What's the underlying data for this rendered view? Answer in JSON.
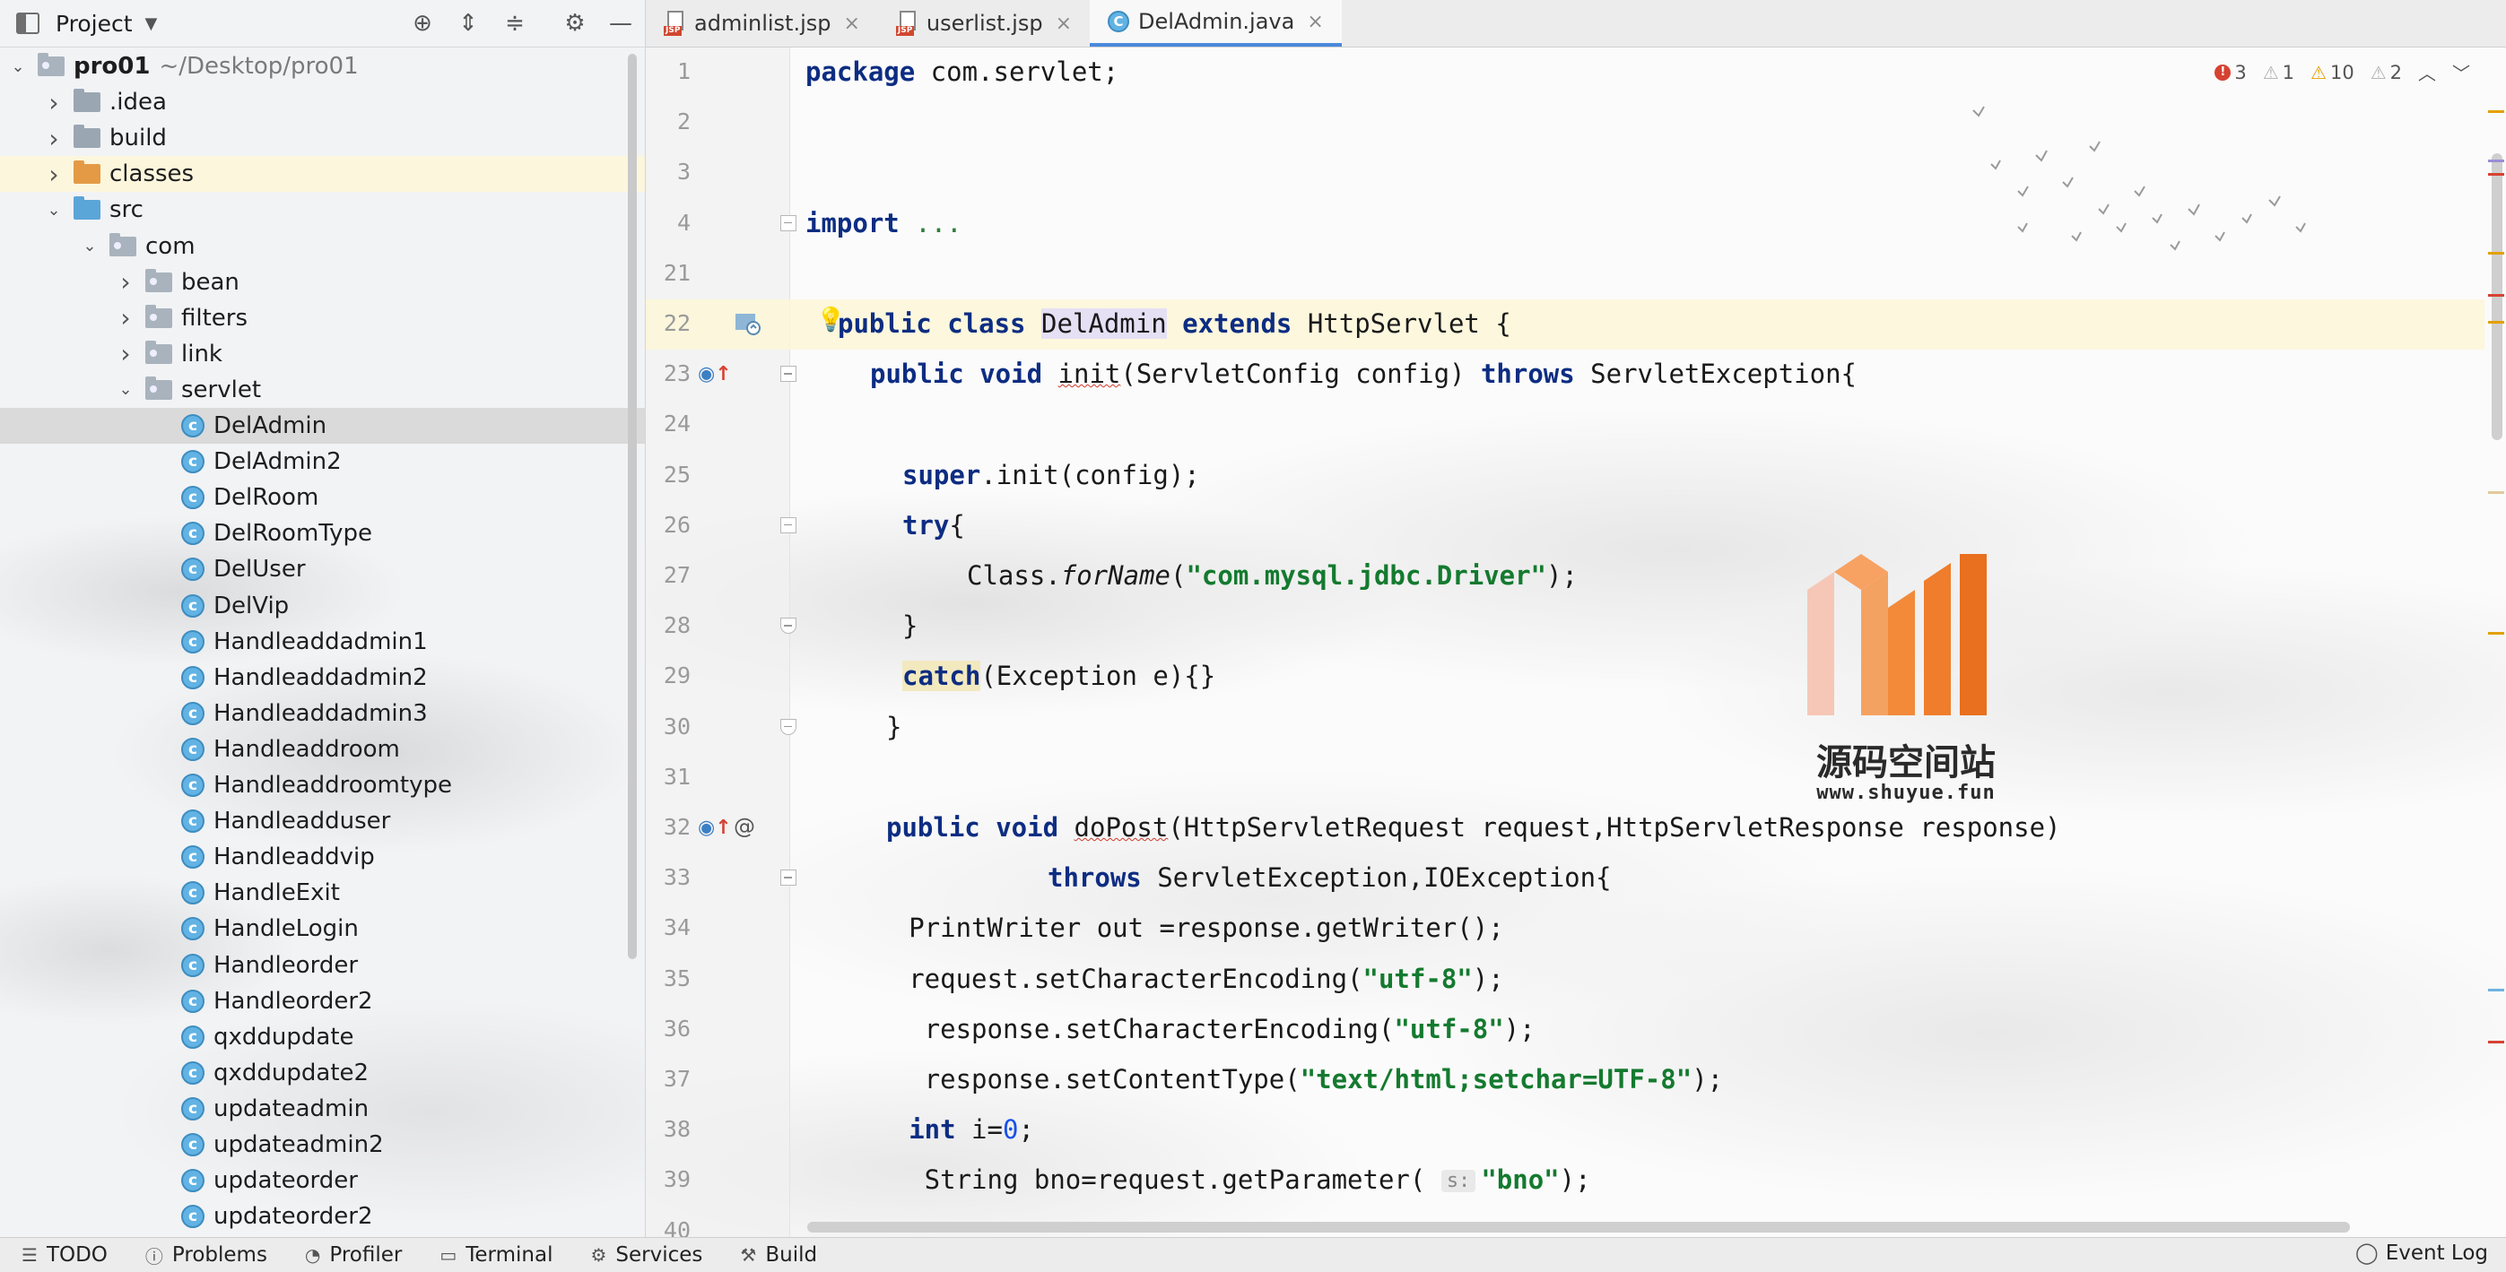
{
  "project_panel": {
    "title": "Project",
    "tree": [
      {
        "label": "pro01",
        "suffix": "~/Desktop/pro01",
        "indent": 0,
        "arrow": "open",
        "kind": "module"
      },
      {
        "label": ".idea",
        "indent": 1,
        "arrow": "closed",
        "kind": "folder"
      },
      {
        "label": "build",
        "indent": 1,
        "arrow": "closed",
        "kind": "folder"
      },
      {
        "label": "classes",
        "indent": 1,
        "arrow": "closed",
        "kind": "folder-orange",
        "highlight": true
      },
      {
        "label": "src",
        "indent": 1,
        "arrow": "open",
        "kind": "folder-blue"
      },
      {
        "label": "com",
        "indent": 2,
        "arrow": "open",
        "kind": "package"
      },
      {
        "label": "bean",
        "indent": 3,
        "arrow": "closed",
        "kind": "package"
      },
      {
        "label": "filters",
        "indent": 3,
        "arrow": "closed",
        "kind": "package"
      },
      {
        "label": "link",
        "indent": 3,
        "arrow": "closed",
        "kind": "package"
      },
      {
        "label": "servlet",
        "indent": 3,
        "arrow": "open",
        "kind": "package"
      },
      {
        "label": "DelAdmin",
        "indent": 4,
        "kind": "class",
        "selected": true
      },
      {
        "label": "DelAdmin2",
        "indent": 4,
        "kind": "class"
      },
      {
        "label": "DelRoom",
        "indent": 4,
        "kind": "class"
      },
      {
        "label": "DelRoomType",
        "indent": 4,
        "kind": "class"
      },
      {
        "label": "DelUser",
        "indent": 4,
        "kind": "class"
      },
      {
        "label": "DelVip",
        "indent": 4,
        "kind": "class"
      },
      {
        "label": "Handleaddadmin1",
        "indent": 4,
        "kind": "class"
      },
      {
        "label": "Handleaddadmin2",
        "indent": 4,
        "kind": "class"
      },
      {
        "label": "Handleaddadmin3",
        "indent": 4,
        "kind": "class"
      },
      {
        "label": "Handleaddroom",
        "indent": 4,
        "kind": "class"
      },
      {
        "label": "Handleaddroomtype",
        "indent": 4,
        "kind": "class"
      },
      {
        "label": "Handleadduser",
        "indent": 4,
        "kind": "class"
      },
      {
        "label": "Handleaddvip",
        "indent": 4,
        "kind": "class"
      },
      {
        "label": "HandleExit",
        "indent": 4,
        "kind": "class"
      },
      {
        "label": "HandleLogin",
        "indent": 4,
        "kind": "class"
      },
      {
        "label": "Handleorder",
        "indent": 4,
        "kind": "class"
      },
      {
        "label": "Handleorder2",
        "indent": 4,
        "kind": "class"
      },
      {
        "label": "qxddupdate",
        "indent": 4,
        "kind": "class"
      },
      {
        "label": "qxddupdate2",
        "indent": 4,
        "kind": "class"
      },
      {
        "label": "updateadmin",
        "indent": 4,
        "kind": "class"
      },
      {
        "label": "updateadmin2",
        "indent": 4,
        "kind": "class"
      },
      {
        "label": "updateorder",
        "indent": 4,
        "kind": "class"
      },
      {
        "label": "updateorder2",
        "indent": 4,
        "kind": "class"
      }
    ]
  },
  "tabs": [
    {
      "label": "adminlist.jsp",
      "icon": "jsp-file-icon",
      "icon_label": "JSP",
      "active": false
    },
    {
      "label": "userlist.jsp",
      "icon": "jsp-file-icon",
      "icon_label": "JSP",
      "active": false
    },
    {
      "label": "DelAdmin.java",
      "icon": "java-class-icon",
      "icon_label": "C",
      "active": true
    }
  ],
  "inspections": {
    "errors": "3",
    "warnings_weak": "1",
    "warnings": "10",
    "typos": "2"
  },
  "editor": {
    "lines": [
      {
        "n": "1",
        "html": "<span class='kw'>package</span> com.servlet;",
        "indent": 0
      },
      {
        "n": "2",
        "html": "",
        "indent": 0
      },
      {
        "n": "3",
        "html": "",
        "indent": 0
      },
      {
        "n": "4",
        "html": "<span class='kw'>import</span> <span style='color:#2f7d3a'>...</span>",
        "indent": 0,
        "fold": "start"
      },
      {
        "n": "21",
        "html": "",
        "indent": 0
      },
      {
        "n": "22",
        "html": "<span class='kw'>public class</span> <span class='class-hl'>DelAdmin</span> <span class='kw'>extends</span> HttpServlet {",
        "indent": 1,
        "current": true,
        "gutter": "class-gutter"
      },
      {
        "n": "23",
        "html": "<span class='kw'>public void</span> <span class='squig'>init</span>(ServletConfig config) <span class='kw'>throws</span> ServletException{",
        "indent": 2,
        "gutter": "override",
        "fold": "start"
      },
      {
        "n": "24",
        "html": "",
        "indent": 0
      },
      {
        "n": "25",
        "html": "<span class='kw'>super</span>.init(config);",
        "indent": 3
      },
      {
        "n": "26",
        "html": "<span class='kw'>try</span>{",
        "indent": 3,
        "fold": "start"
      },
      {
        "n": "27",
        "html": "Class.<i>forName</i>(<span class='str'>\"com.mysql.jdbc.Driver\"</span>);",
        "indent": 5
      },
      {
        "n": "28",
        "html": "}",
        "indent": 3,
        "fold": "end"
      },
      {
        "n": "29",
        "html": "<span class='kw catch-hl'>catch</span>(Exception e){}",
        "indent": 3
      },
      {
        "n": "30",
        "html": "}",
        "indent": 2.5,
        "fold": "end"
      },
      {
        "n": "31",
        "html": "",
        "indent": 0
      },
      {
        "n": "32",
        "html": "<span class='kw'>public void</span> <span class='squig'>doPost</span>(HttpServletRequest request,HttpServletResponse response)",
        "indent": 2.5,
        "gutter": "override-at"
      },
      {
        "n": "33",
        "html": "<span class='kw'>throws</span> ServletException,IOException{",
        "indent": 7.5,
        "fold": "start"
      },
      {
        "n": "34",
        "html": "PrintWriter out =response.getWriter();",
        "indent": 3.2
      },
      {
        "n": "35",
        "html": "request.setCharacterEncoding(<span class='str'>\"utf-8\"</span>);",
        "indent": 3.2
      },
      {
        "n": "36",
        "html": " response.setCharacterEncoding(<span class='str'>\"utf-8\"</span>);",
        "indent": 3.2
      },
      {
        "n": "37",
        "html": " response.setContentType(<span class='str'>\"text/html;setchar=UTF-8\"</span>);",
        "indent": 3.2
      },
      {
        "n": "38",
        "html": "<span class='kw'>int</span> i=<span class='num'>0</span>;",
        "indent": 3.2
      },
      {
        "n": "39",
        "html": " String bno=request.getParameter( <span class='hint'>s:</span><span class='str'>\"bno\"</span>);",
        "indent": 3.2
      },
      {
        "n": "40",
        "html": "",
        "indent": 0
      }
    ]
  },
  "watermark": {
    "title": "源码空间站",
    "url": "www.shuyue.fun"
  },
  "bottom_bar": {
    "tools": [
      {
        "label": "TODO",
        "icon": "list-icon"
      },
      {
        "label": "Problems",
        "icon": "problems-icon"
      },
      {
        "label": "Profiler",
        "icon": "profiler-icon"
      },
      {
        "label": "Terminal",
        "icon": "terminal-icon"
      },
      {
        "label": "Services",
        "icon": "services-icon"
      },
      {
        "label": "Build",
        "icon": "hammer-icon"
      }
    ],
    "event_log": "Event Log"
  },
  "colors": {
    "accent": "#4a89dc",
    "error": "#d64232",
    "warning": "#e3a000",
    "keyword": "#0d2d82",
    "string": "#147a2f"
  }
}
